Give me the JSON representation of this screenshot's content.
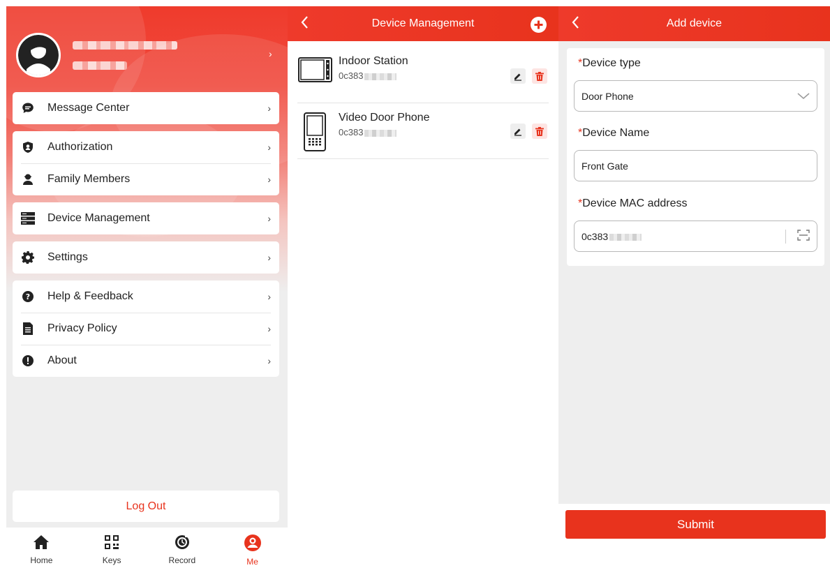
{
  "me_screen": {
    "menu_groups": [
      [
        {
          "label": "Message Center",
          "icon": "chat-bubble-icon"
        }
      ],
      [
        {
          "label": "Authorization",
          "icon": "shield-user-icon"
        },
        {
          "label": "Family Members",
          "icon": "person-icon"
        }
      ],
      [
        {
          "label": "Device Management",
          "icon": "server-icon"
        }
      ],
      [
        {
          "label": "Settings",
          "icon": "gear-icon"
        }
      ],
      [
        {
          "label": "Help & Feedback",
          "icon": "question-circle-icon"
        },
        {
          "label": "Privacy Policy",
          "icon": "document-icon"
        },
        {
          "label": "About",
          "icon": "info-circle-icon"
        }
      ]
    ],
    "chevron": "›",
    "logout_label": "Log Out",
    "tabs": [
      {
        "label": "Home",
        "icon": "home-icon",
        "active": false
      },
      {
        "label": "Keys",
        "icon": "qr-code-icon",
        "active": false
      },
      {
        "label": "Record",
        "icon": "record-clock-icon",
        "active": false
      },
      {
        "label": "Me",
        "icon": "user-circle-icon",
        "active": true
      }
    ]
  },
  "device_management": {
    "title": "Device Management",
    "devices": [
      {
        "name": "Indoor Station",
        "mac_prefix": "0c383",
        "icon": "indoor-monitor-icon"
      },
      {
        "name": "Video Door Phone",
        "mac_prefix": "0c383",
        "icon": "door-phone-icon"
      }
    ]
  },
  "add_device": {
    "title": "Add device",
    "required_mark": "*",
    "device_type_label": "Device type",
    "device_type_value": "Door Phone",
    "device_name_label": "Device Name",
    "device_name_value": "Front Gate",
    "mac_label": "Device MAC address",
    "mac_value_prefix": "0c383",
    "submit_label": "Submit"
  },
  "colors": {
    "brand_red": "#e8331d",
    "background_gray": "#eeeeee"
  }
}
